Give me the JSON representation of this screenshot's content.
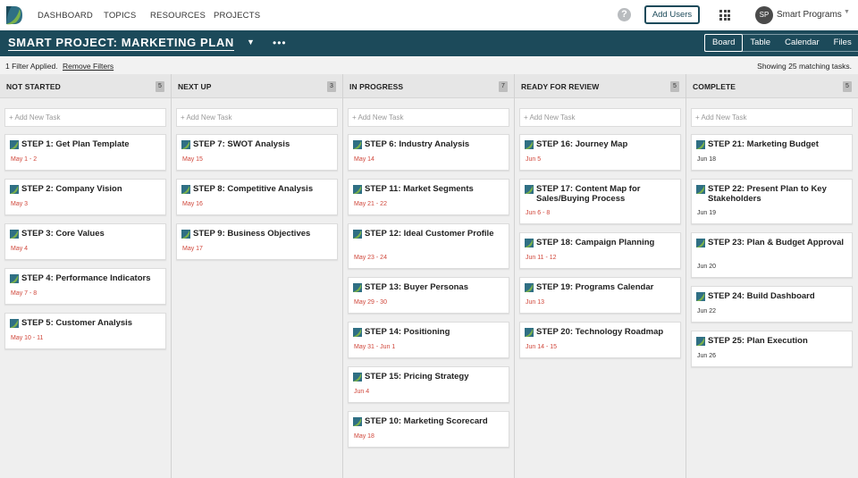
{
  "nav": {
    "items": [
      {
        "label": "DASHBOARD",
        "active": true
      },
      {
        "label": "TOPICS",
        "active": false
      },
      {
        "label": "RESOURCES",
        "active": false
      },
      {
        "label": "PROJECTS",
        "active": false
      }
    ],
    "help_icon": "?",
    "add_users_label": "Add Users",
    "apps_icon": "grid-icon",
    "avatar_initials": "SP",
    "user_name": "Smart Programs"
  },
  "project": {
    "title": "SMART PROJECT: MARKETING PLAN",
    "more": "•••",
    "views": [
      {
        "label": "Board",
        "active": true
      },
      {
        "label": "Table",
        "active": false
      },
      {
        "label": "Calendar",
        "active": false
      },
      {
        "label": "Files",
        "active": false
      }
    ]
  },
  "filter": {
    "applied_text": "1 Filter Applied.",
    "remove_label": "Remove Filters",
    "showing_text": "Showing 25 matching tasks."
  },
  "colors": {
    "brand": "#1c4a5a",
    "date_red": "#d0463a",
    "date_dark": "#333333"
  },
  "board": {
    "add_task_placeholder": "+ Add New Task",
    "columns": [
      {
        "title": "NOT STARTED",
        "count": "5",
        "tasks": [
          {
            "title": "STEP 1: Get Plan Template",
            "date": "May 1 - 2",
            "overdue": true
          },
          {
            "title": "STEP 2: Company Vision",
            "date": "May 3",
            "overdue": true
          },
          {
            "title": "STEP 3: Core Values",
            "date": "May 4",
            "overdue": true
          },
          {
            "title": "STEP 4: Performance Indicators",
            "date": "May 7 - 8",
            "overdue": true
          },
          {
            "title": "STEP 5: Customer Analysis",
            "date": "May 10 - 11",
            "overdue": true
          }
        ]
      },
      {
        "title": "NEXT UP",
        "count": "3",
        "tasks": [
          {
            "title": "STEP 7: SWOT Analysis",
            "date": "May 15",
            "overdue": true
          },
          {
            "title": "STEP 8: Competitive Analysis",
            "date": "May 16",
            "overdue": true
          },
          {
            "title": "STEP 9: Business Objectives",
            "date": "May 17",
            "overdue": true
          }
        ]
      },
      {
        "title": "IN PROGRESS",
        "count": "7",
        "tasks": [
          {
            "title": "STEP 6: Industry Analysis",
            "date": "May 14",
            "overdue": true
          },
          {
            "title": "STEP 11: Market Segments",
            "date": "May 21 - 22",
            "overdue": true
          },
          {
            "title": "STEP 12: Ideal Customer Profile",
            "date": "May 23 - 24",
            "overdue": true
          },
          {
            "title": "STEP 13: Buyer Personas",
            "date": "May 29 - 30",
            "overdue": true
          },
          {
            "title": "STEP 14: Positioning",
            "date": "May 31 - Jun 1",
            "overdue": true
          },
          {
            "title": "STEP 15: Pricing Strategy",
            "date": "Jun 4",
            "overdue": true
          },
          {
            "title": "STEP 10: Marketing Scorecard",
            "date": "May 18",
            "overdue": true
          }
        ]
      },
      {
        "title": "READY FOR REVIEW",
        "count": "5",
        "tasks": [
          {
            "title": "STEP 16: Journey Map",
            "date": "Jun 5",
            "overdue": true
          },
          {
            "title": "STEP 17: Content Map for Sales/Buying Process",
            "date": "Jun 6 - 8",
            "overdue": true
          },
          {
            "title": "STEP 18: Campaign Planning",
            "date": "Jun 11 - 12",
            "overdue": true
          },
          {
            "title": "STEP 19: Programs Calendar",
            "date": "Jun 13",
            "overdue": true
          },
          {
            "title": "STEP 20: Technology Roadmap",
            "date": "Jun 14 - 15",
            "overdue": true
          }
        ]
      },
      {
        "title": "COMPLETE",
        "count": "5",
        "tasks": [
          {
            "title": "STEP 21: Marketing Budget",
            "date": "Jun 18",
            "overdue": false
          },
          {
            "title": "STEP 22: Present Plan to Key Stakeholders",
            "date": "Jun 19",
            "overdue": false
          },
          {
            "title": "STEP 23: Plan & Budget Approval",
            "date": "Jun 20",
            "overdue": false
          },
          {
            "title": "STEP 24: Build Dashboard",
            "date": "Jun 22",
            "overdue": false
          },
          {
            "title": "STEP 25: Plan Execution",
            "date": "Jun 26",
            "overdue": false
          }
        ]
      }
    ]
  }
}
